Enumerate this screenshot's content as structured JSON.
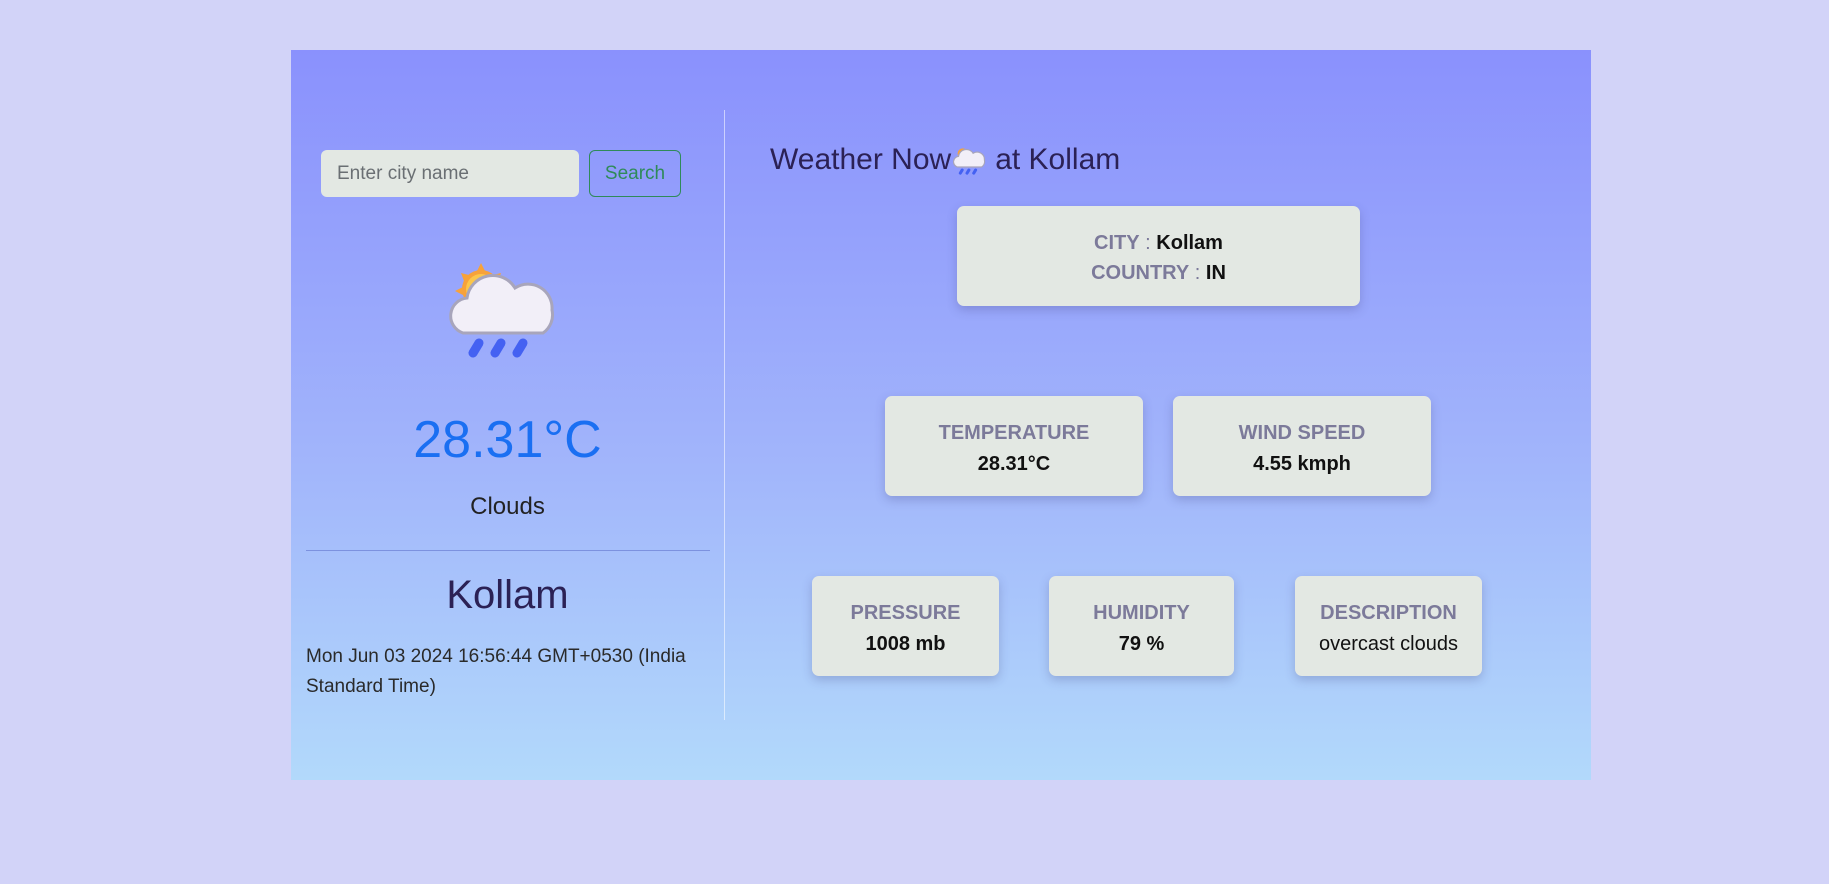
{
  "search": {
    "placeholder": "Enter city name",
    "button_label": "Search"
  },
  "current": {
    "icon": "cloud-sun-rain-icon",
    "temperature": "28.31°C",
    "condition": "Clouds",
    "city": "Kollam",
    "datetime": "Mon Jun 03 2024 16:56:44 GMT+0530 (India Standard Time)"
  },
  "details": {
    "title_prefix": "Weather Now",
    "title_icon": "cloud-sun-rain-icon",
    "title_suffix": "at Kollam",
    "city_label": "CITY",
    "city_value": "Kollam",
    "country_label": "COUNTRY",
    "country_value": "IN",
    "separator": ":",
    "temperature_label": "TEMPERATURE",
    "temperature_value": "28.31°C",
    "wind_label": "WIND SPEED",
    "wind_value": "4.55 kmph",
    "pressure_label": "PRESSURE",
    "pressure_value": "1008 mb",
    "humidity_label": "HUMIDITY",
    "humidity_value": "79 %",
    "description_label": "DESCRIPTION",
    "description_value": "overcast clouds"
  },
  "colors": {
    "page_background": "#d2d3f8",
    "accent_temperature": "#1a6ff2",
    "search_button": "#2f8a5a",
    "card_background": "#e3e8e3"
  }
}
